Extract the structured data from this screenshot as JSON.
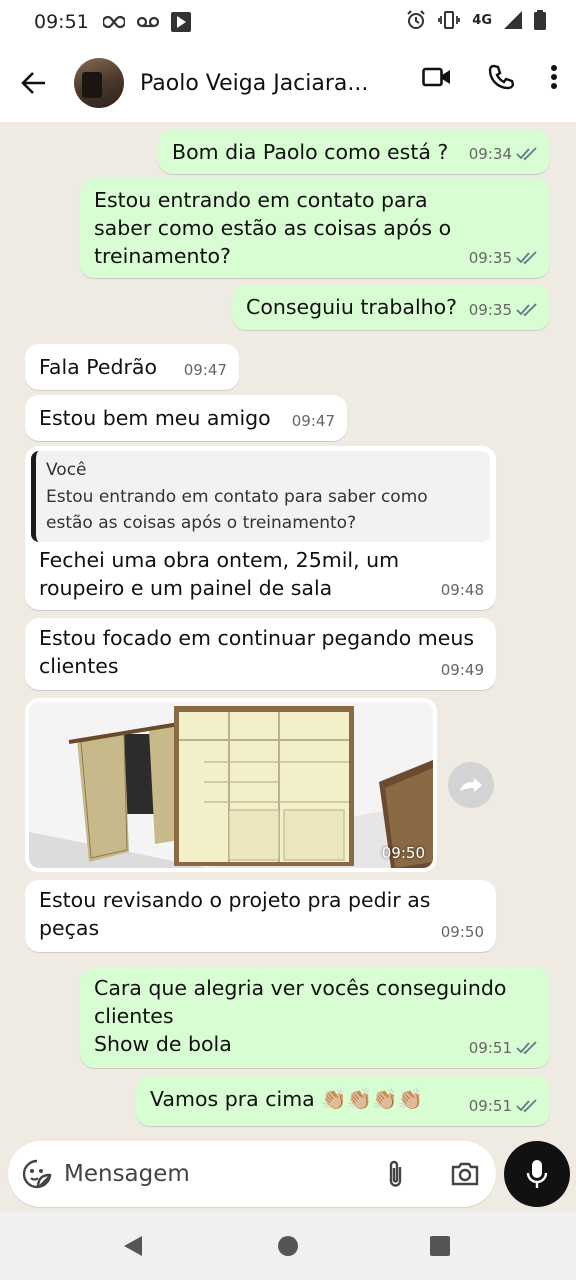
{
  "status_bar": {
    "time": "09:51",
    "network": "4G"
  },
  "header": {
    "contact_name": "Paolo Veiga Jaciara..."
  },
  "messages": [
    {
      "dir": "out",
      "text": "Bom dia Paolo como está ?",
      "time": "09:34"
    },
    {
      "dir": "out",
      "text": "Estou entrando em contato para\nsaber como estão as coisas após o\ntreinamento?",
      "time": "09:35"
    },
    {
      "dir": "out",
      "text": "Conseguiu trabalho?",
      "time": "09:35"
    },
    {
      "dir": "in",
      "text": "Fala Pedrão",
      "time": "09:47"
    },
    {
      "dir": "in",
      "text": "Estou bem meu amigo",
      "time": "09:47"
    },
    {
      "dir": "in",
      "quote_author": "Você",
      "quote_text": "Estou entrando em contato para saber como\nestão as coisas após o treinamento?",
      "text": "Fechei uma obra ontem, 25mil, um\nroupeiro e um painel de sala",
      "time": "09:48"
    },
    {
      "dir": "in",
      "text": "Estou focado em continuar pegando meus\nclientes",
      "time": "09:49"
    },
    {
      "dir": "in",
      "image": "wardrobe-3d-render",
      "time": "09:50"
    },
    {
      "dir": "in",
      "text": "Estou revisando o projeto pra pedir as\npeças",
      "time": "09:50"
    },
    {
      "dir": "out",
      "text": "Cara que alegria ver vocês conseguindo\nclientes\nShow de bola",
      "time": "09:51"
    },
    {
      "dir": "out",
      "text": "Vamos pra cima 👏🏼👏🏼👏🏼👏🏼",
      "time": "09:51"
    }
  ],
  "composer": {
    "placeholder": "Mensagem"
  },
  "colors": {
    "outgoing_bubble": "#d9fdd3",
    "incoming_bubble": "#ffffff",
    "read_ticks": "#667781",
    "background": "#efeae2"
  }
}
